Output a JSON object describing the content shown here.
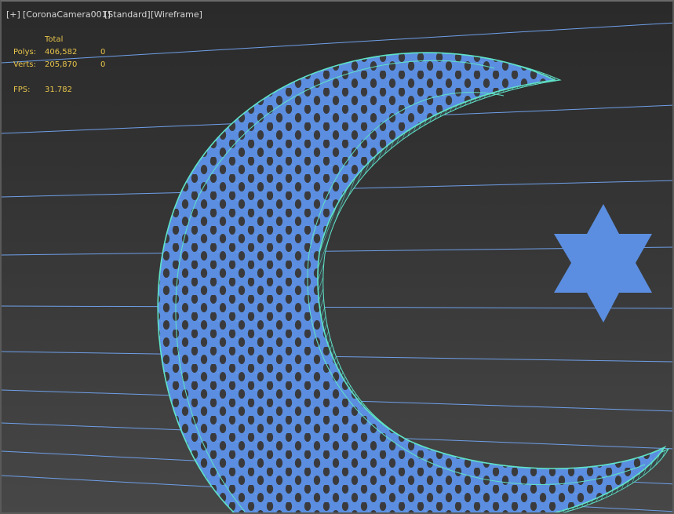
{
  "viewport": {
    "labels": [
      "[+]",
      "[CoronaCamera001]",
      "[Standard]",
      "[Wireframe]"
    ],
    "stats": {
      "header": "Total",
      "polys_label": "Polys:",
      "polys_total": "406,582",
      "polys_selected": "0",
      "verts_label": "Verts:",
      "verts_total": "205,870",
      "verts_selected": "0",
      "fps_label": "FPS:",
      "fps_value": "31.782"
    }
  },
  "colors": {
    "object_fill": "#5b8ee0",
    "hole": "#3a3a3d",
    "edge_wire": "#5fe3c7",
    "grid_line": "#6f9fe8",
    "stats_text": "#e6c34a"
  }
}
